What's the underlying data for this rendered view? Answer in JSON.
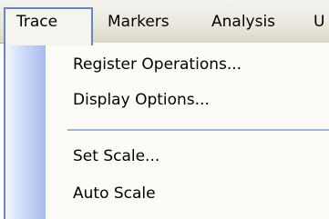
{
  "menubar": {
    "items": [
      {
        "label": "Trace",
        "active": true
      },
      {
        "label": "Markers"
      },
      {
        "label": "Analysis"
      },
      {
        "label": "U"
      }
    ]
  },
  "dropdown": {
    "items": [
      {
        "label": "Register Operations..."
      },
      {
        "label": "Display Options..."
      },
      {
        "label": "Set Scale..."
      },
      {
        "label": "Auto Scale"
      }
    ]
  },
  "colors": {
    "accent_border": "#6a86c4",
    "gutter_gradient_end": "#a5bcec",
    "separator": "#9fb2df"
  }
}
